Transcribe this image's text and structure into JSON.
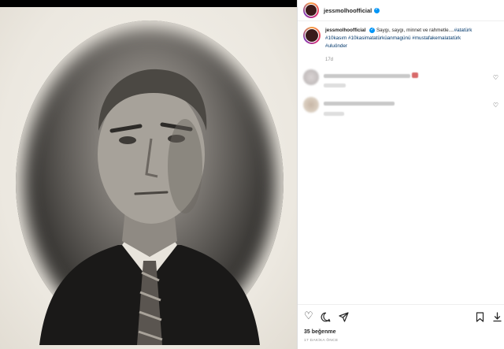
{
  "post": {
    "username": "jessmolhoofficial",
    "caption_text": "Saygı, saygı, minnet ve rahmetle....",
    "hashtags_line1": "#atatürk",
    "hashtags_line2": "#10kasım #10kasimatatürküanmagünü #mustafakemalatatürk",
    "hashtags_line3": "#uluönder",
    "age": "17d"
  },
  "engagement": {
    "likes": "35 beğenme",
    "time": "17 DAKİKA ÖNCE"
  },
  "icons": {
    "verified": "verified-badge-icon",
    "like": "heart-icon",
    "comment": "comment-icon",
    "share": "share-icon",
    "save": "bookmark-icon",
    "download": "download-icon"
  },
  "colors": {
    "verified": "#0095f6",
    "hashtag": "#00376b",
    "muted": "#8e8e8e"
  }
}
